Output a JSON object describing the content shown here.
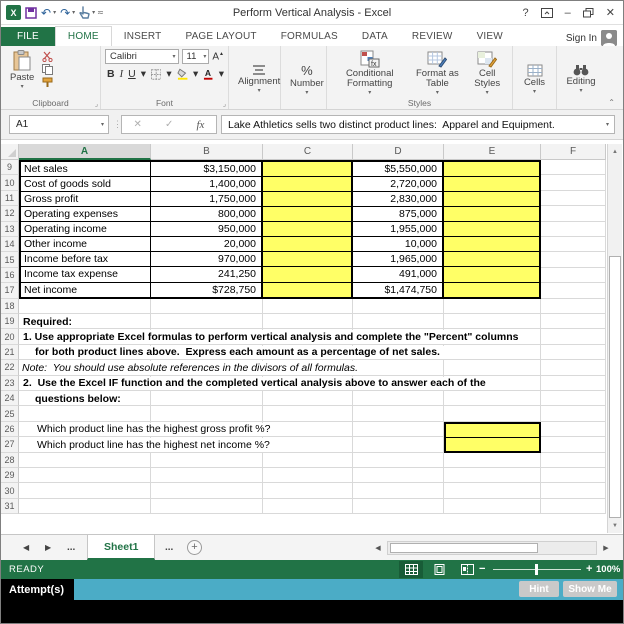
{
  "title_bar": {
    "title": "Perform Vertical Analysis - Excel",
    "help": "?",
    "minimize": "–",
    "close": "✕"
  },
  "tabs": {
    "items": [
      "FILE",
      "HOME",
      "INSERT",
      "PAGE LAYOUT",
      "FORMULAS",
      "DATA",
      "REVIEW",
      "VIEW"
    ],
    "selected": "HOME",
    "sign_in": "Sign In"
  },
  "ribbon": {
    "clipboard": {
      "label": "Clipboard",
      "paste": "Paste"
    },
    "font": {
      "label": "Font",
      "family": "Calibri",
      "size": "11",
      "bold": "B",
      "italic": "I",
      "underline": "U"
    },
    "alignment": {
      "label": "Alignment"
    },
    "number": {
      "label": "Number",
      "icon": "%"
    },
    "styles": {
      "label": "Styles",
      "conditional": "Conditional Formatting",
      "format_table": "Format as Table",
      "cell_styles": "Cell Styles"
    },
    "cells": {
      "label": "Cells"
    },
    "editing": {
      "label": "Editing"
    }
  },
  "formula_bar": {
    "name_box": "A1",
    "fx": "fx",
    "value": "Lake Athletics sells two distinct product lines:  Apparel and Equipment."
  },
  "sheet": {
    "columns": [
      "A",
      "B",
      "C",
      "D",
      "E",
      "F"
    ],
    "selected_column": "A",
    "first_row": 9,
    "last_row": 31,
    "income_statement": [
      {
        "label": "Net sales",
        "product1": "$3,150,000",
        "product2": "$5,550,000"
      },
      {
        "label": "Cost of goods sold",
        "product1": "1,400,000",
        "product2": "2,720,000"
      },
      {
        "label": "Gross profit",
        "product1": "1,750,000",
        "product2": "2,830,000"
      },
      {
        "label": "Operating expenses",
        "product1": "800,000",
        "product2": "875,000"
      },
      {
        "label": "Operating income",
        "product1": "950,000",
        "product2": "1,955,000"
      },
      {
        "label": "Other income",
        "product1": "20,000",
        "product2": "10,000"
      },
      {
        "label": "Income before tax",
        "product1": "970,000",
        "product2": "1,965,000"
      },
      {
        "label": "Income tax expense",
        "product1": "241,250",
        "product2": "491,000"
      },
      {
        "label": "Net income",
        "product1": "$728,750",
        "product2": "$1,474,750"
      }
    ],
    "lines": {
      "required": "Required:",
      "instr1": "1. Use appropriate Excel formulas to perform vertical analysis and complete the \"Percent\" columns",
      "instr1b": "for both product lines above.  Express each amount as a percentage of net sales.",
      "note": "Note:  You should use absolute references in the divisors of all formulas.",
      "instr2": "2.  Use the Excel IF function and the completed vertical analysis above to answer each of the",
      "instr2b": "questions below:",
      "q1": "Which product line has the highest gross profit %?",
      "q2": "Which product line has the highest net income %?"
    }
  },
  "sheet_tabs": {
    "active": "Sheet1",
    "ellipsis_left": "...",
    "ellipsis_right": "..."
  },
  "status": {
    "mode": "READY",
    "zoom_level": "100%"
  },
  "attempt_bar": {
    "label": "Attempt(s)",
    "hint_button": "Hint",
    "show_me_button": "Show Me"
  },
  "colors": {
    "excel_green": "#217346",
    "input_yellow": "#FFFF66",
    "attempt_teal": "#4BACC6"
  }
}
